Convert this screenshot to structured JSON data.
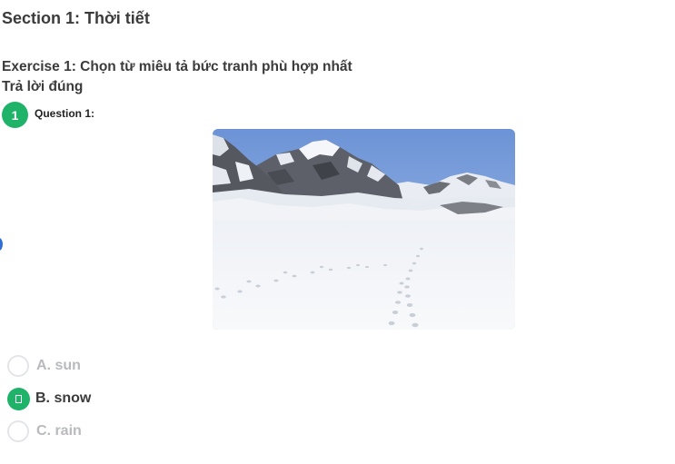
{
  "section": {
    "title": "Section 1: Thời tiết"
  },
  "exercise": {
    "title": "Exercise 1: Chọn từ miêu tả bức tranh phù hợp nhất",
    "status": "Trả lời đúng"
  },
  "question": {
    "number": "1",
    "label": "Question 1:",
    "image_icon": "snowy-mountain-photo"
  },
  "options": [
    {
      "label": "A. sun",
      "selected": false
    },
    {
      "label": "B. snow",
      "selected": true
    },
    {
      "label": "C. rain",
      "selected": false
    }
  ],
  "colors": {
    "accent": "#1fb36a",
    "text": "#3b3b3b",
    "muted": "#b8babd",
    "radio_border": "#e3e5e8"
  }
}
